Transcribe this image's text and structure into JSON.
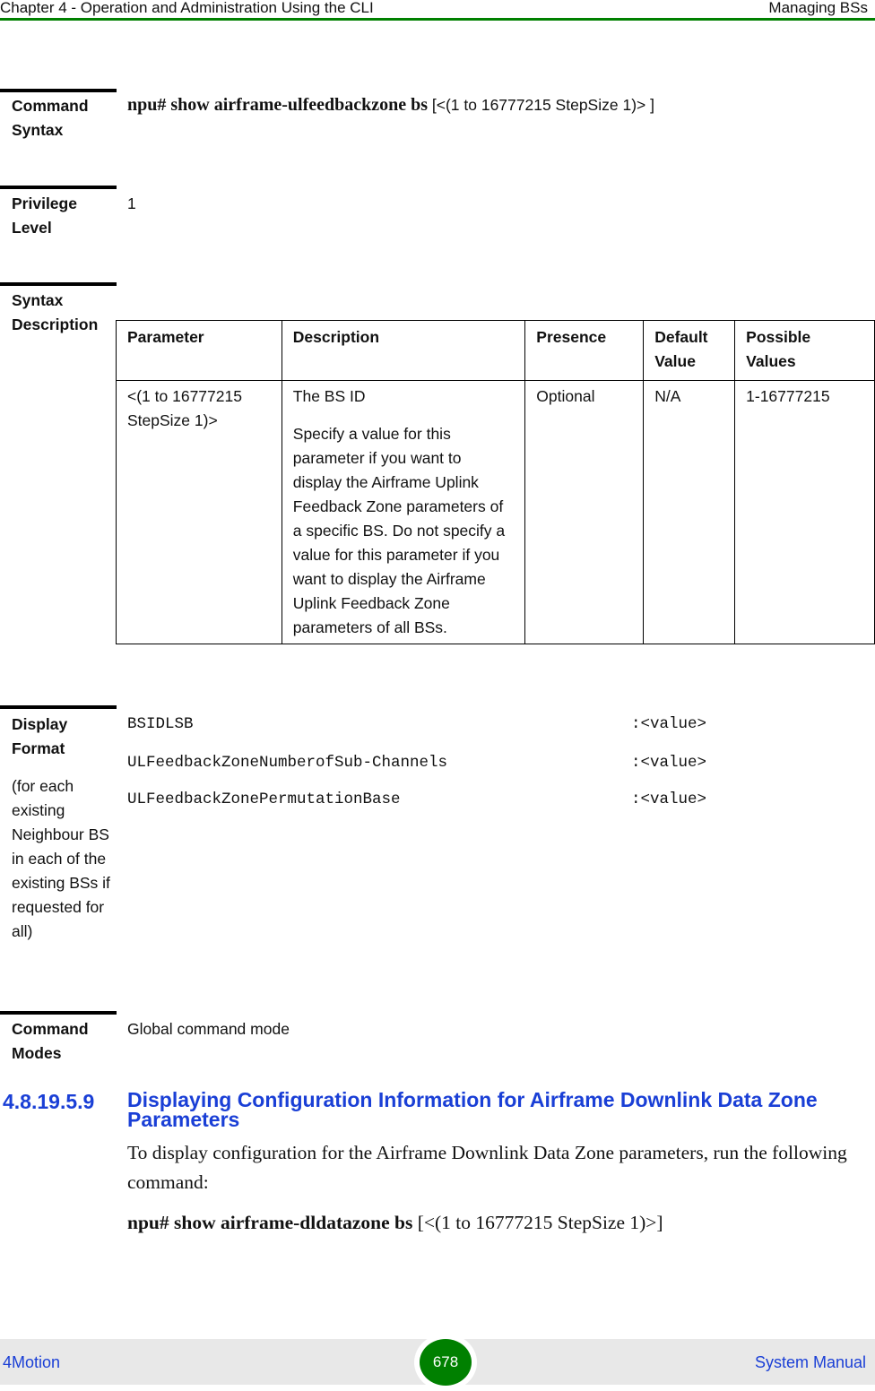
{
  "header": {
    "chapter": "Chapter 4 - Operation and Administration Using the CLI",
    "section": "Managing BSs",
    "rule_color": "#008000"
  },
  "command_syntax": {
    "label_line1": "Command",
    "label_line2": "Syntax",
    "command": "npu# show airframe-ulfeedbackzone bs",
    "argument": " [<(1 to 16777215 StepSize 1)> ]"
  },
  "privilege_level": {
    "label_line1": "Privilege",
    "label_line2": "Level",
    "value": "1"
  },
  "syntax_description": {
    "label_line1": "Syntax",
    "label_line2": "Description",
    "columns": [
      "Parameter",
      "Description",
      "Presence",
      "Default Value",
      "Possible Values"
    ],
    "rows": [
      {
        "parameter": "<(1 to 16777215 StepSize 1)>",
        "description_title": "The BS ID",
        "description_body": "Specify a value for this parameter if you want to display the Airframe Uplink Feedback Zone parameters of a specific BS. Do not specify a value for this parameter if you want to display the Airframe Uplink Feedback Zone parameters of all BSs.",
        "presence": "Optional",
        "default_value": "N/A",
        "possible_values": "1-16777215"
      }
    ]
  },
  "display_format": {
    "label_line1": "Display",
    "label_line2": "Format",
    "note": "(for each existing Neighbour BS in each of the existing BSs if requested for all)",
    "lines": [
      {
        "key": "BSIDLSB",
        "value": ":<value>"
      },
      {
        "key": "ULFeedbackZoneNumberofSub-Channels",
        "value": ":<value>"
      },
      {
        "key": "ULFeedbackZonePermutationBase",
        "value": ":<value>"
      }
    ]
  },
  "command_modes": {
    "label_line1": "Command",
    "label_line2": "Modes",
    "value": "Global command mode"
  },
  "section": {
    "number": "4.8.19.5.9",
    "title": "Displaying Configuration Information for Airframe Downlink Data Zone Parameters",
    "body": "To display configuration for the Airframe Downlink Data Zone parameters, run the following command:",
    "command": "npu# show airframe-dldatazone bs",
    "argument": " [<(1 to 16777215 StepSize 1)>]",
    "title_color": "#1a3fd6"
  },
  "footer": {
    "left": "4Motion",
    "page": "678",
    "right": "System Manual",
    "page_badge_color": "#008000"
  }
}
